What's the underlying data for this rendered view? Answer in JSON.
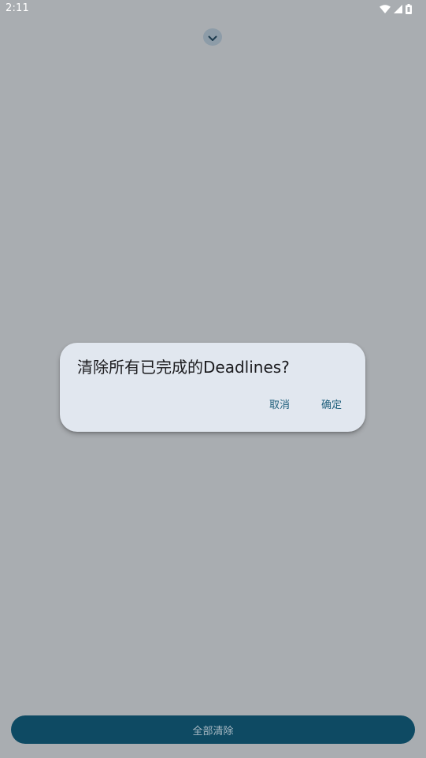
{
  "status_bar": {
    "time": "2:11",
    "icons": [
      "wifi-icon",
      "signal-icon",
      "battery-icon"
    ]
  },
  "top": {
    "expand_icon": "chevron-down-icon"
  },
  "dialog": {
    "title": "清除所有已完成的Deadlines?",
    "cancel_label": "取消",
    "confirm_label": "确定"
  },
  "bottom": {
    "clear_all_label": "全部清除"
  },
  "colors": {
    "scrim_background": "#a9adb1",
    "dialog_background": "#e1e7ef",
    "accent": "#1f5f7c",
    "primary_button": "#0e4a63"
  }
}
